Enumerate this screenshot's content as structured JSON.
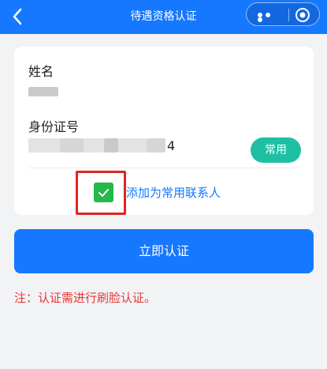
{
  "header": {
    "title": "待遇资格认证",
    "back_icon": "chevron-left-icon",
    "more_icon": "more-dots-icon",
    "close_icon": "target-circle-icon",
    "color": "#1677ff"
  },
  "form": {
    "name_label": "姓名",
    "id_label": "身份证号",
    "id_visible_tail": "4",
    "frequent_button": "常用",
    "add_contact_text": "添加为常用联系人",
    "add_contact_checked": true
  },
  "actions": {
    "verify_button": "立即认证"
  },
  "footer": {
    "note": "注：认证需进行刷脸认证。"
  },
  "colors": {
    "accent": "#1677ff",
    "success": "#25b84a",
    "teal": "#1fbfa3",
    "warning": "#e53935",
    "highlight_border": "#e02424"
  }
}
